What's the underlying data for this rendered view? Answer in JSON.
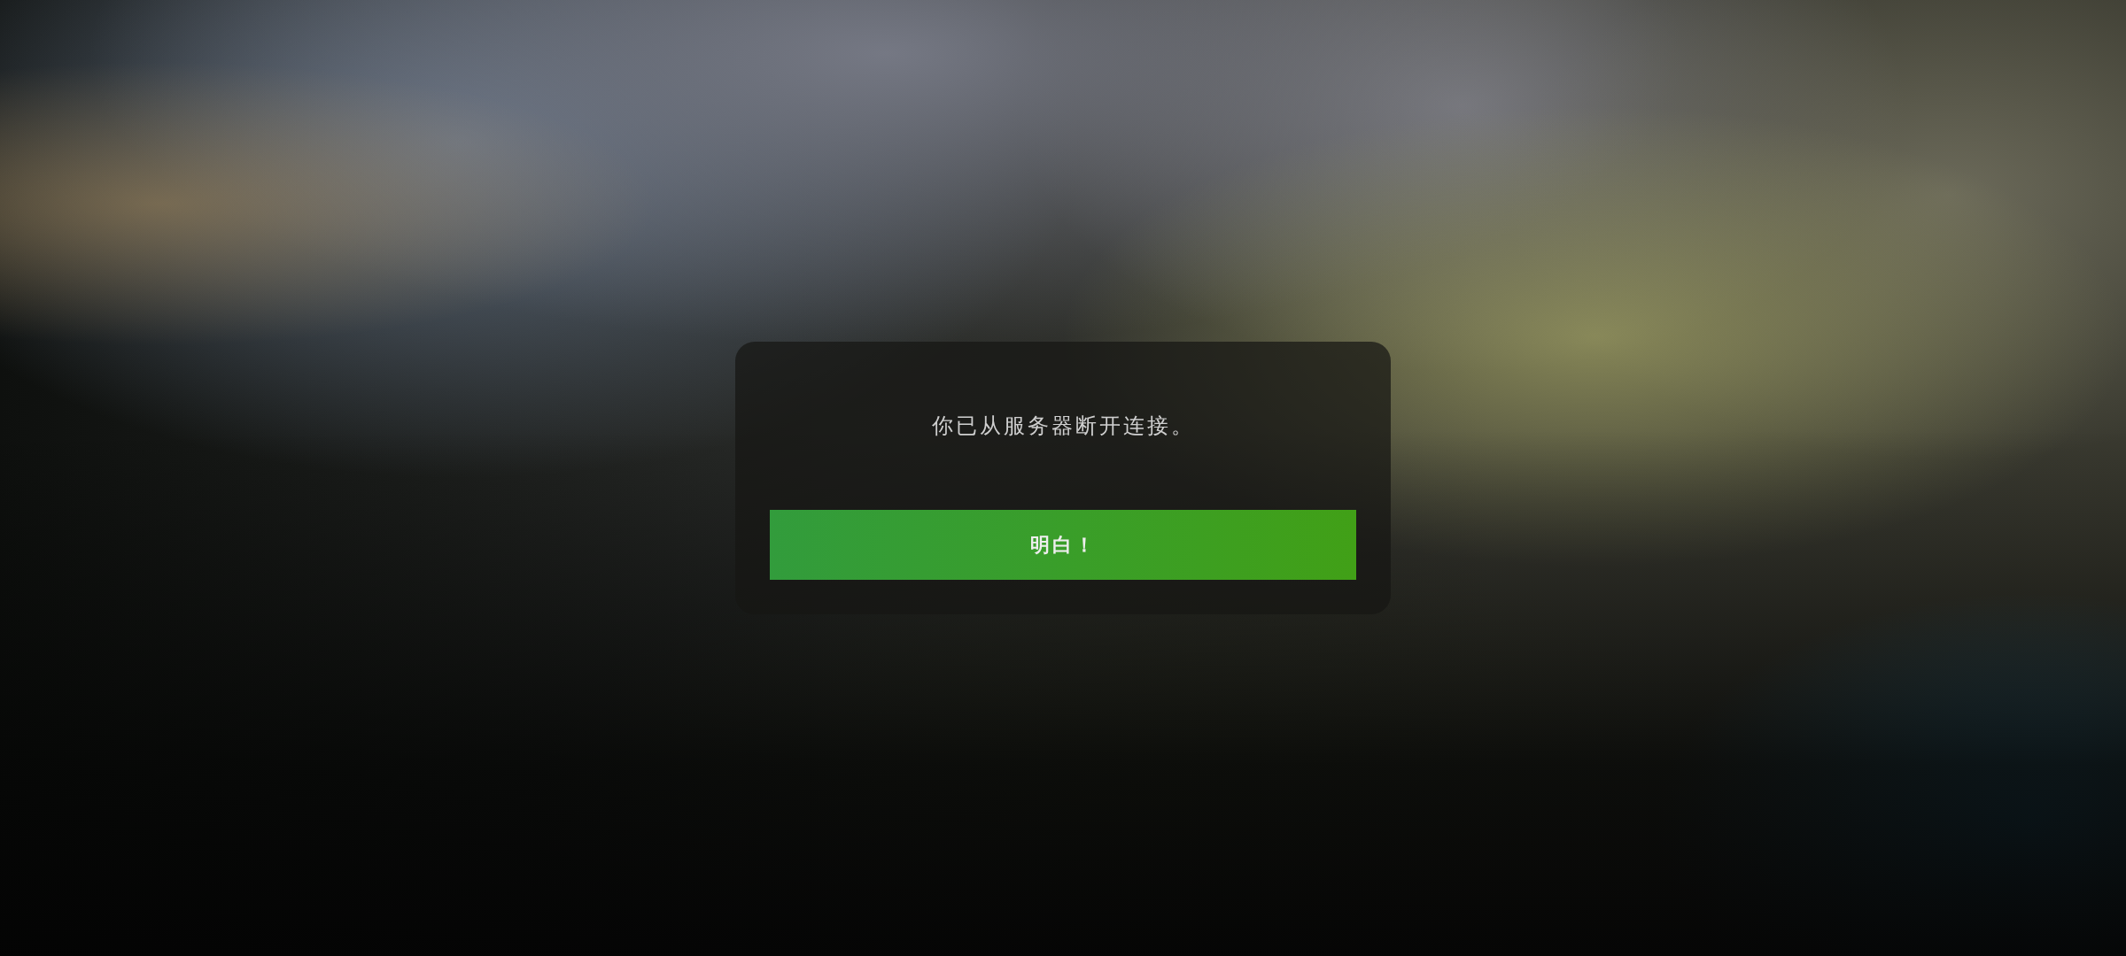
{
  "dialog": {
    "message": "你已从服务器断开连接。",
    "button": "明白！"
  }
}
